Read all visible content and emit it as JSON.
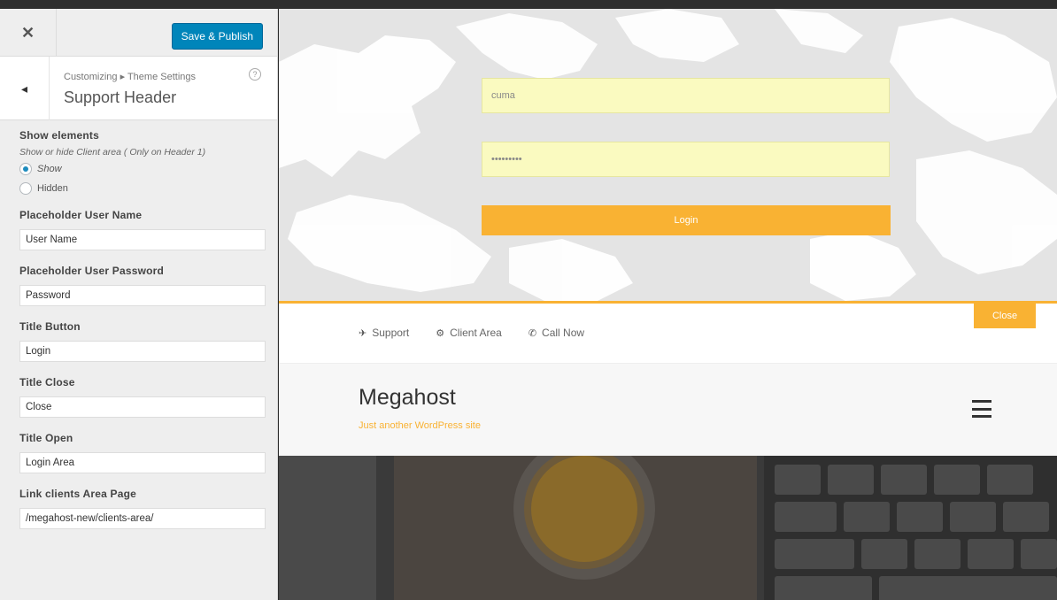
{
  "panel": {
    "close_glyph": "✕",
    "publish_label": "Save & Publish",
    "back_glyph": "◂",
    "breadcrumb": "Customizing ▸ Theme Settings",
    "help_glyph": "?",
    "section_title": "Support Header"
  },
  "controls": {
    "show_elements": {
      "title": "Show elements",
      "description": "Show or hide Client area ( Only on Header 1)",
      "options": [
        {
          "label": "Show",
          "selected": true
        },
        {
          "label": "Hidden",
          "selected": false
        }
      ]
    },
    "fields": [
      {
        "title": "Placeholder User Name",
        "value": "User Name"
      },
      {
        "title": "Placeholder User Password",
        "value": "Password"
      },
      {
        "title": "Title Button",
        "value": "Login"
      },
      {
        "title": "Title Close",
        "value": "Close"
      },
      {
        "title": "Title Open",
        "value": "Login Area"
      },
      {
        "title": "Link clients Area Page",
        "value": "/megahost-new/clients-area/"
      }
    ]
  },
  "preview": {
    "login": {
      "username_value": "cuma",
      "password_value": "•••••••••",
      "button_label": "Login",
      "close_label": "Close"
    },
    "support_links": [
      {
        "icon": "✈",
        "label": "Support"
      },
      {
        "icon": "⚙",
        "label": "Client Area"
      },
      {
        "icon": "✆",
        "label": "Call Now"
      }
    ],
    "site_title": "Megahost",
    "site_tagline": "Just another WordPress site"
  },
  "colors": {
    "accent": "#f9b233",
    "primary_button": "#0085ba",
    "autofill": "#fafac0"
  }
}
